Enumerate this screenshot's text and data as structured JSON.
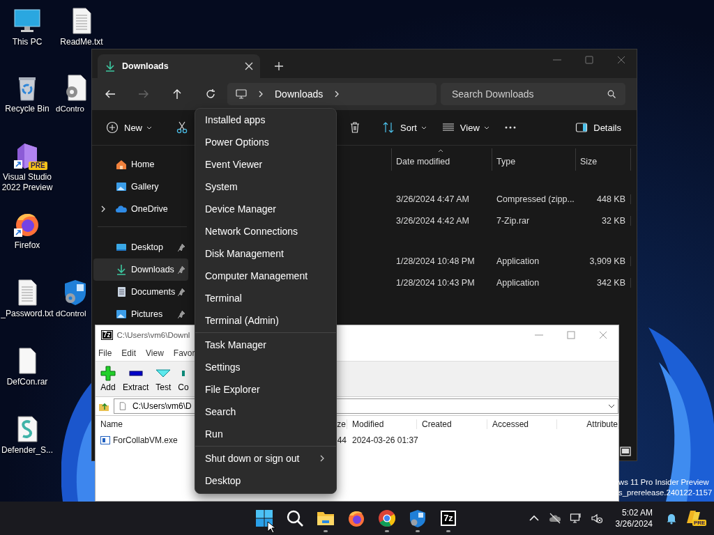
{
  "desktop_icons": [
    {
      "label": "This PC",
      "kind": "monitor",
      "shortcut": false
    },
    {
      "label": "ReadMe.txt",
      "kind": "text-file",
      "shortcut": false
    },
    {
      "label": "Recycle Bin",
      "kind": "recycle-bin",
      "shortcut": false
    },
    {
      "label": "dContro",
      "kind": "settings-file",
      "shortcut": false
    },
    {
      "label": "Visual Studio 2022 Preview",
      "kind": "visual-studio",
      "shortcut": true,
      "badge": "PRE"
    },
    {
      "label": "Firefox",
      "kind": "firefox",
      "shortcut": true
    },
    {
      "label": "_Password.txt",
      "kind": "text-file",
      "shortcut": false
    },
    {
      "label": "dControl",
      "kind": "shield-app",
      "shortcut": false
    },
    {
      "label": "DefCon.rar",
      "kind": "blank-file",
      "shortcut": false
    },
    {
      "label": "Defender_S...",
      "kind": "script-file",
      "shortcut": false
    }
  ],
  "explorer": {
    "tab": {
      "title": "Downloads"
    },
    "address": [
      "Downloads"
    ],
    "search": {
      "placeholder": "Search Downloads"
    },
    "commands": [
      {
        "label": "New",
        "kind": "new",
        "dropdown": true
      },
      {
        "kind": "cut",
        "dropdown": false
      },
      {
        "kind": "delete",
        "dropdown": false
      },
      {
        "label": "Sort",
        "kind": "sort",
        "dropdown": true
      },
      {
        "label": "View",
        "kind": "view",
        "dropdown": true
      },
      {
        "kind": "more",
        "dropdown": false
      },
      {
        "label": "Details",
        "kind": "details",
        "dropdown": false
      }
    ],
    "sidebar": [
      [
        {
          "label": "Home",
          "kind": "home",
          "pinned": false,
          "selected": false,
          "expandable": false
        },
        {
          "label": "Gallery",
          "kind": "gallery",
          "pinned": false,
          "selected": false,
          "expandable": false
        },
        {
          "label": "OneDrive",
          "kind": "onedrive",
          "pinned": false,
          "selected": false,
          "expandable": true
        }
      ],
      [
        {
          "label": "Desktop",
          "kind": "desktop",
          "pinned": true,
          "selected": false,
          "expandable": false
        },
        {
          "label": "Downloads",
          "kind": "downloads",
          "pinned": true,
          "selected": true,
          "expandable": false
        },
        {
          "label": "Documents",
          "kind": "documents",
          "pinned": true,
          "selected": false,
          "expandable": false
        },
        {
          "label": "Pictures",
          "kind": "pictures",
          "pinned": true,
          "selected": false,
          "expandable": false
        }
      ]
    ],
    "columns": [
      {
        "label": "Date modified",
        "sorted": true
      },
      {
        "label": "Type",
        "sorted": false
      },
      {
        "label": "Size",
        "sorted": false
      }
    ],
    "groups": [
      [
        {
          "date": "3/26/2024 4:47 AM",
          "type": "Compressed (zipp...",
          "size": "448 KB"
        },
        {
          "date": "3/26/2024 4:42 AM",
          "type": "7-Zip.rar",
          "size": "32 KB"
        }
      ],
      [
        {
          "date": "1/28/2024 10:48 PM",
          "type": "Application",
          "size": "3,909 KB"
        },
        {
          "date": "1/28/2024 10:43 PM",
          "type": "Application",
          "size": "342 KB"
        }
      ]
    ]
  },
  "sevenzip": {
    "logo": "7z",
    "title": "C:\\Users\\vm6\\Downl",
    "menu": [
      "File",
      "Edit",
      "View",
      "Favor"
    ],
    "tools": [
      {
        "label": "Add",
        "kind": "add"
      },
      {
        "label": "Extract",
        "kind": "extract"
      },
      {
        "label": "Test",
        "kind": "test"
      },
      {
        "label": "Co",
        "kind": "copy"
      }
    ],
    "path": "C:\\Users\\vm6\\D",
    "columns": [
      "Name",
      "ze",
      "Modified",
      "Created",
      "Accessed",
      "Attribute"
    ],
    "rows": [
      {
        "name": "ForCollabVM.exe",
        "size": "44",
        "modified": "2024-03-26 01:37"
      }
    ]
  },
  "context_menu": {
    "sections": [
      [
        {
          "label": "Installed apps",
          "submenu": false
        },
        {
          "label": "Power Options",
          "submenu": false
        },
        {
          "label": "Event Viewer",
          "submenu": false
        },
        {
          "label": "System",
          "submenu": false
        },
        {
          "label": "Device Manager",
          "submenu": false
        },
        {
          "label": "Network Connections",
          "submenu": false
        },
        {
          "label": "Disk Management",
          "submenu": false
        },
        {
          "label": "Computer Management",
          "submenu": false
        },
        {
          "label": "Terminal",
          "submenu": false
        },
        {
          "label": "Terminal (Admin)",
          "submenu": false
        }
      ],
      [
        {
          "label": "Task Manager",
          "submenu": false
        },
        {
          "label": "Settings",
          "submenu": false
        },
        {
          "label": "File Explorer",
          "submenu": false
        },
        {
          "label": "Search",
          "submenu": false
        },
        {
          "label": "Run",
          "submenu": false
        }
      ],
      [
        {
          "label": "Shut down or sign out",
          "submenu": true
        },
        {
          "label": "Desktop",
          "submenu": false
        }
      ]
    ]
  },
  "watermark": [
    "ws 11 Pro Insider Preview",
    "s_prerelease.240122-1157"
  ],
  "taskbar": {
    "apps": [
      {
        "kind": "start",
        "running": false
      },
      {
        "kind": "search",
        "running": false
      },
      {
        "kind": "file-explorer",
        "running": true
      },
      {
        "kind": "firefox",
        "running": false
      },
      {
        "kind": "chrome",
        "running": true
      },
      {
        "kind": "shield-app",
        "running": true
      },
      {
        "kind": "archiver",
        "running": true,
        "glyph": "7z"
      }
    ],
    "tray": [
      {
        "kind": "chevron"
      },
      {
        "kind": "cloud"
      },
      {
        "kind": "network"
      },
      {
        "kind": "speaker"
      }
    ],
    "clock": {
      "time": "5:02 AM",
      "date": "3/26/2024"
    },
    "copilot_badge": "PRE"
  }
}
